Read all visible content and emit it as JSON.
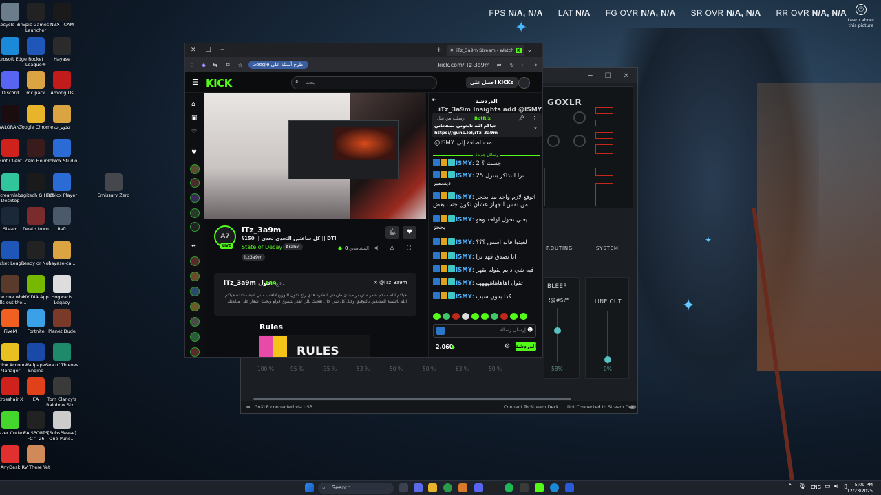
{
  "overlay": {
    "fps_label": "FPS",
    "fps_value": "N/A, N/A",
    "lat_label": "LAT",
    "lat_value": "N/A",
    "fg_label": "FG OVR",
    "fg_value": "N/A, N/A",
    "sr_label": "SR OVR",
    "sr_value": "N/A, N/A",
    "rr_label": "RR OVR",
    "rr_value": "N/A, N/A",
    "learn": "Learn about this picture"
  },
  "desktop_icons": [
    {
      "label": "Recycle Bin",
      "color": "#6b7c8a"
    },
    {
      "label": "Epic Games Launcher",
      "color": "#222"
    },
    {
      "label": "NZXT CAM",
      "color": "#1a1a1a"
    },
    {
      "label": "Microsoft Edge",
      "color": "#1a8ad8"
    },
    {
      "label": "Rocket League®",
      "color": "#1e57b8"
    },
    {
      "label": "Hayase",
      "color": "#2b2b2b"
    },
    {
      "label": "Discord",
      "color": "#5865f2"
    },
    {
      "label": "mc pack",
      "color": "#d9a441"
    },
    {
      "label": "Among Us",
      "color": "#c21b1b"
    },
    {
      "label": "VALORANT",
      "color": "#1a0c0f"
    },
    {
      "label": "Google Chrome",
      "color": "#e7b42a"
    },
    {
      "label": "تحويرات",
      "color": "#d9a441"
    },
    {
      "label": "Riot Client",
      "color": "#d0221c"
    },
    {
      "label": "Zero Hour",
      "color": "#3a1b1b"
    },
    {
      "label": "Roblox Studio",
      "color": "#2a6bd6"
    },
    {
      "label": "Streamlabs Desktop",
      "color": "#30c59b"
    },
    {
      "label": "Logitech G HUB",
      "color": "#1a1a1a"
    },
    {
      "label": "Roblox Player",
      "color": "#2a6bd6"
    },
    {
      "label": "Emissary Zero",
      "color": "#44484c"
    },
    {
      "label": "Steam",
      "color": "#1b2838"
    },
    {
      "label": "Death town",
      "color": "#7a2b2b"
    },
    {
      "label": "Raft",
      "color": "#4a5a6a"
    },
    {
      "label": "Rocket League",
      "color": "#1e57b8"
    },
    {
      "label": "Ready or Not",
      "color": "#222"
    },
    {
      "label": "hayase-ca...",
      "color": "#d9a441"
    },
    {
      "label": "The one who pulls out the...",
      "color": "#5a3a2a"
    },
    {
      "label": "NVIDIA App",
      "color": "#76b900"
    },
    {
      "label": "Hogwarts Legacy",
      "color": "#ddd"
    },
    {
      "label": "FiveM",
      "color": "#f06020"
    },
    {
      "label": "Fortnite",
      "color": "#3aa0e8"
    },
    {
      "label": "Planet Dude",
      "color": "#7a3a2a"
    },
    {
      "label": "Roblox Account Manager",
      "color": "#e8c020"
    },
    {
      "label": "Wallpaper Engine",
      "color": "#1a4aa8"
    },
    {
      "label": "Sea of Thieves",
      "color": "#1e8a6a"
    },
    {
      "label": "Crosshair X",
      "color": "#d0221c"
    },
    {
      "label": "EA",
      "color": "#e0401a"
    },
    {
      "label": "Tom Clancy's Rainbow Six...",
      "color": "#3a3a3a"
    },
    {
      "label": "Razer Cortex",
      "color": "#44d62c"
    },
    {
      "label": "EA SPORTS FC™ 26",
      "color": "#222"
    },
    {
      "label": "[SubsPlease] One-Punc...",
      "color": "#ccc"
    },
    {
      "label": "AnyDesk",
      "color": "#e03030"
    },
    {
      "label": "RV There Yet",
      "color": "#d08a5a"
    }
  ],
  "goxlr": {
    "logo": "GOXLR",
    "tabs": [
      "ROUTING",
      "SYSTEM"
    ],
    "bleep": "BLEEP",
    "bleep_sub": "!@#$?*",
    "line_out": "LINE OUT",
    "fader_percents": [
      "58%",
      "0%"
    ],
    "bottom_percents": [
      "100 %",
      "95 %",
      "35 %",
      "53 %",
      "50 %",
      "50 %",
      "63 %",
      "50 %"
    ],
    "status_left": "GoXLR connected via USB",
    "status_mid": "Connect To Stream Deck",
    "status_right": "Not Connected to Stream Deck"
  },
  "browser": {
    "tab_title": "iTz_3a9m Stream - Watch Live",
    "url": "kick.com/iTz-3a9m",
    "google_pill": "Google اطرح أسئلة على",
    "search_placeholder": "بحث",
    "get_kicks": "احصل على KICKs",
    "stream": {
      "streamer": "iTz_3a9m",
      "title": "كل ساعتين التحدي تحدي || 150؟ || DT!",
      "game": "State of Decay 2",
      "language": "Arabic",
      "tag": "itz3a9m",
      "viewers_label": "المشاهدين",
      "viewers": "0",
      "live": "LIVE",
      "about_title": "iTz_3a9m حول",
      "followers_count": "139",
      "followers_label": "متابع",
      "twitter": "@iTz_3a9m",
      "about_text": "حياكم الله ممكم عامر ستريمر مبتدئ طريقتي الفكرة هذي راح تكون التوزيع لالعاب ماني لعبة محددة حياكم الله بالنسبة للمتابعين بالتوفيق وقبل كل شي حال تعجبك بالي لقدر لتسوي فولو ويجيك اشعار على متابعتك",
      "rules": "Rules",
      "rules_img": "RULES"
    },
    "chat": {
      "header": "الدردشة",
      "pinned_by": "BotRix",
      "pinned_label": "أرسلت من قبل",
      "pinned_text": "حياكم الله تابعوني بصفحاتي",
      "pinned_link": "https://guns.lol/iTz_3a9m",
      "partial_top": "iTz_3a9m Insights add @ISMY",
      "partial_text": "@ISMY. تمت اضافة إلى",
      "new_messages": "رسائل جديدة",
      "messages": [
        {
          "user": "ISMY",
          "text": "جست ؟ 2"
        },
        {
          "user": "ISMY",
          "text": "ترا التذاكر بتنزل 25 ديسمبر"
        },
        {
          "user": "ISMY",
          "text": "اتوقع لازم واحد منا يحجز من نفس الجهاز عشان نكون جنب بعض"
        },
        {
          "user": "ISMY",
          "text": "يعني نحول لواحد وهو يحجز"
        },
        {
          "user": "ISMY",
          "text": "لعبتوا فالو اسس ؟؟؟"
        },
        {
          "user": "ISMY",
          "text": "انا بصدق فهد ترا"
        },
        {
          "user": "ISMY",
          "text": "فيه شي دايم يقوله يقهر"
        },
        {
          "user": "ISMY",
          "text": "تقول اهاهاهاهههههه"
        },
        {
          "user": "ISMY",
          "text": "كذا بدون سبب"
        }
      ],
      "input_placeholder": "إرسال رسالة",
      "kicks": "2,060",
      "send_label": "الدردشة"
    }
  },
  "taskbar": {
    "search": "Search",
    "lang": "ENG",
    "time": "5:09 PM",
    "date": "12/23/2025"
  }
}
